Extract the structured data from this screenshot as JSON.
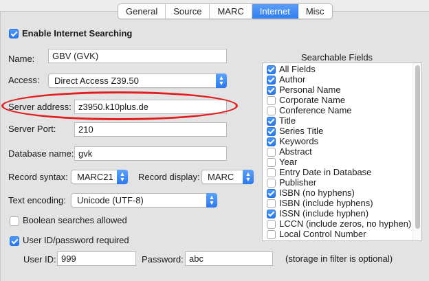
{
  "tabs": [
    {
      "label": "General",
      "active": false
    },
    {
      "label": "Source",
      "active": false
    },
    {
      "label": "MARC",
      "active": false
    },
    {
      "label": "Internet",
      "active": true
    },
    {
      "label": "Misc",
      "active": false
    }
  ],
  "enable_searching": {
    "label": "Enable Internet Searching",
    "checked": true
  },
  "name": {
    "label": "Name:",
    "value": "GBV (GVK)"
  },
  "access": {
    "label": "Access:",
    "value": "Direct Access Z39.50"
  },
  "server_address": {
    "label": "Server address:",
    "value": "z3950.k10plus.de"
  },
  "server_port": {
    "label": "Server Port:",
    "value": "210"
  },
  "database_name": {
    "label": "Database name:",
    "value": "gvk"
  },
  "record_syntax": {
    "label": "Record syntax:",
    "value": "MARC21"
  },
  "record_display": {
    "label": "Record display:",
    "value": "MARC"
  },
  "text_encoding": {
    "label": "Text encoding:",
    "value": "Unicode (UTF-8)"
  },
  "boolean_searches": {
    "label": "Boolean searches allowed",
    "checked": false
  },
  "userid_required": {
    "label": "User ID/password required",
    "checked": true
  },
  "user_id": {
    "label": "User ID:",
    "value": "999"
  },
  "password": {
    "label": "Password:",
    "value": "abc"
  },
  "storage_note": "(storage in filter is optional)",
  "searchable_fields": {
    "title": "Searchable Fields",
    "items": [
      {
        "label": "All Fields",
        "checked": true
      },
      {
        "label": "Author",
        "checked": true
      },
      {
        "label": "Personal Name",
        "checked": true
      },
      {
        "label": "Corporate Name",
        "checked": false
      },
      {
        "label": "Conference Name",
        "checked": false
      },
      {
        "label": "Title",
        "checked": true
      },
      {
        "label": "Series Title",
        "checked": true
      },
      {
        "label": "Keywords",
        "checked": true
      },
      {
        "label": "Abstract",
        "checked": false
      },
      {
        "label": "Year",
        "checked": false
      },
      {
        "label": "Entry Date in Database",
        "checked": false
      },
      {
        "label": "Publisher",
        "checked": false
      },
      {
        "label": "ISBN (no hyphens)",
        "checked": true
      },
      {
        "label": "ISBN (include hyphens)",
        "checked": false
      },
      {
        "label": "ISSN (include hyphen)",
        "checked": true
      },
      {
        "label": "LCCN (include zeros, no hyphen)",
        "checked": false
      },
      {
        "label": "Local Control Number",
        "checked": false
      }
    ]
  },
  "colors": {
    "accent": "#2f7df0",
    "highlight_oval": "#e11d1d"
  }
}
